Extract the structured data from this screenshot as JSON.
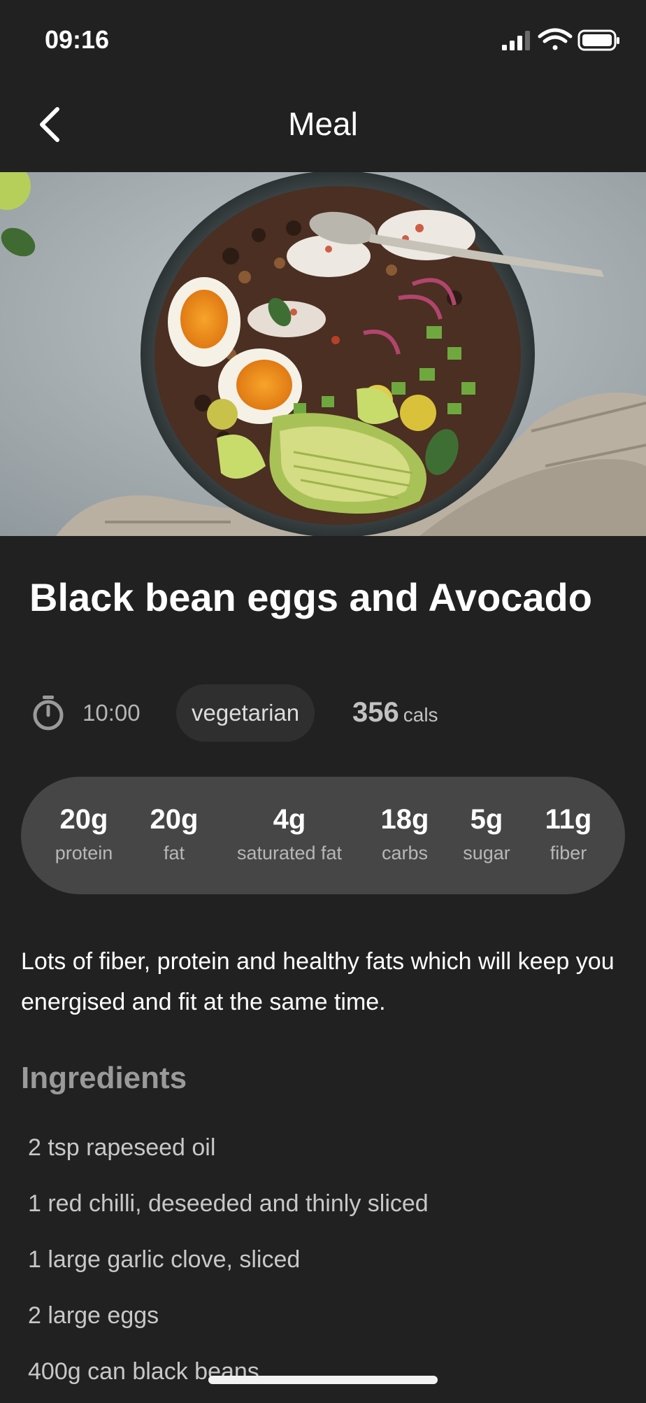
{
  "status_bar": {
    "time": "09:16",
    "icons": [
      "cellular-signal-icon",
      "wifi-icon",
      "battery-icon"
    ]
  },
  "nav": {
    "title": "Meal",
    "back_icon": "chevron-left-icon"
  },
  "hero": {
    "image": "black-bean-eggs-avocado-bowl-photo"
  },
  "meal": {
    "title": "Black bean eggs and Avocado",
    "prep_time": "10:00",
    "tag": "vegetarian",
    "calories": "356",
    "calories_unit": "cals"
  },
  "nutrition": [
    {
      "value": "20g",
      "label": "protein"
    },
    {
      "value": "20g",
      "label": "fat"
    },
    {
      "value": "4g",
      "label": "saturated fat"
    },
    {
      "value": "18g",
      "label": "carbs"
    },
    {
      "value": "5g",
      "label": "sugar"
    },
    {
      "value": "11g",
      "label": "fiber"
    }
  ],
  "description": "Lots of fiber, protein and healthy fats which will keep you energised and fit at the same time.",
  "ingredients": {
    "heading": "Ingredients",
    "items": [
      "2 tsp rapeseed oil",
      "1 red chilli, deseeded and thinly sliced",
      "1 large garlic clove, sliced",
      "2 large eggs",
      "400g can black beans"
    ]
  },
  "colors": {
    "background": "#212121",
    "nutrition_panel": "#464646",
    "tag_chip": "#2f2f2f",
    "heading_muted": "#9a9a9a"
  }
}
